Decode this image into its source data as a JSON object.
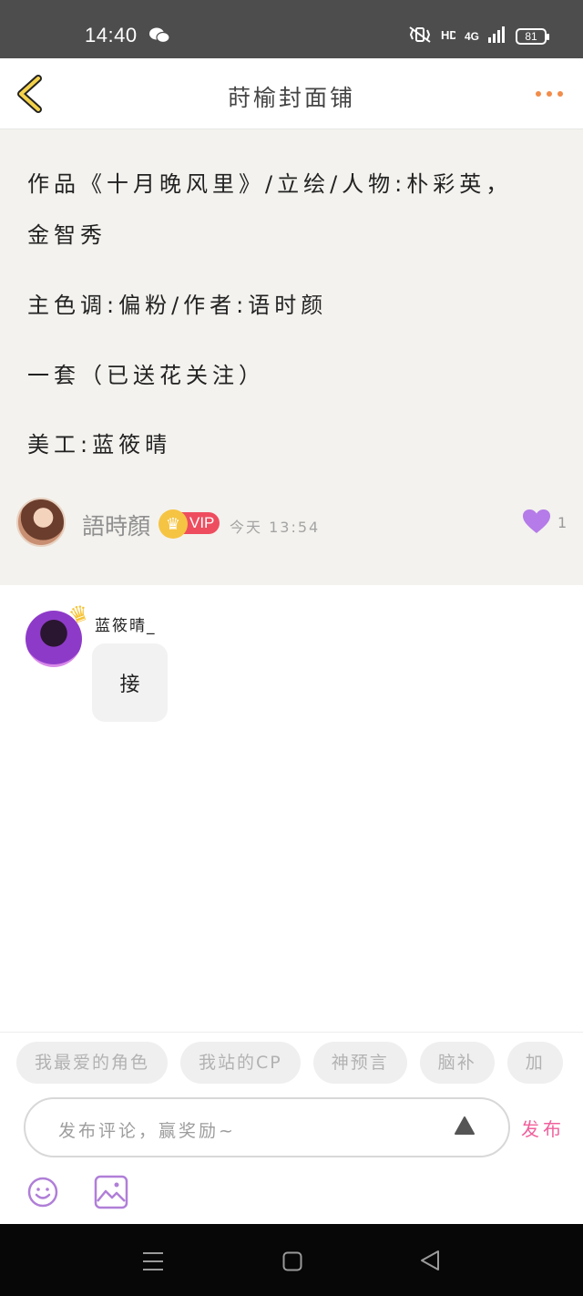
{
  "status_bar": {
    "time": "14:40",
    "network": "4G",
    "battery": "81",
    "icons": [
      "wechat-icon",
      "vibrate-icon",
      "hd-icon",
      "signal-icon",
      "battery-icon"
    ]
  },
  "header": {
    "title": "莳榆封面铺",
    "back_icon": "chevron-left-icon",
    "more_icon": "more-dots-icon",
    "accent_color": "#f28c4a"
  },
  "post": {
    "lines": [
      "作品《十月晚风里》/立绘/人物:朴彩英，",
      "金智秀",
      "主色调:偏粉/作者:语时颜",
      "一套（已送花关注）",
      "美工:蓝筱晴"
    ],
    "author": {
      "name": "語時顏",
      "badge": "VIP",
      "time": "今天 13:54"
    },
    "likes": "1",
    "like_color": "#b57be8"
  },
  "comments": [
    {
      "author": "蓝筱晴_",
      "text": "接"
    }
  ],
  "composer": {
    "tags": [
      "我最爱的角色",
      "我站的CP",
      "神预言",
      "脑补",
      "加"
    ],
    "placeholder": "发布评论，赢奖励~",
    "publish_label": "发布",
    "publish_color": "#f0609c"
  },
  "system_nav": {
    "icons": [
      "menu-icon",
      "home-icon",
      "back-triangle-icon"
    ]
  }
}
